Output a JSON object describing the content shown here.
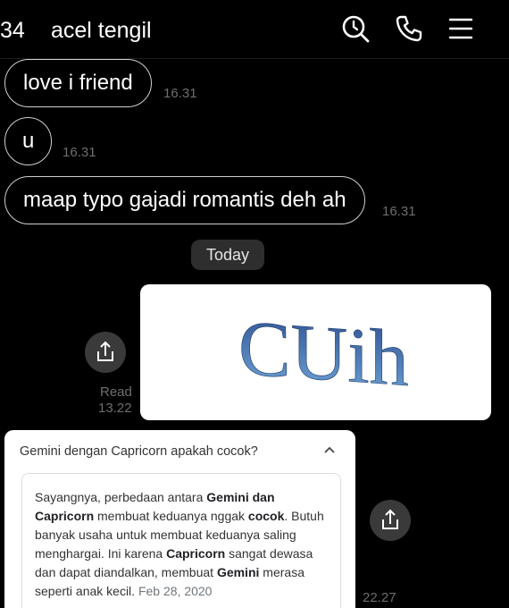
{
  "header": {
    "back_count": "34",
    "title": "acel tengil",
    "icons": [
      "search-icon",
      "phone-icon",
      "menu-icon"
    ]
  },
  "messages": [
    {
      "text": "love i friend",
      "time": "16.31"
    },
    {
      "text": "u",
      "time": "16.31"
    },
    {
      "text": "maap typo gajadi romantis deh ah",
      "time": "16.31"
    }
  ],
  "date_divider": "Today",
  "image_message": {
    "image_text": "CUih",
    "status": "Read",
    "time": "13.22"
  },
  "search_snippet": {
    "question": "Gemini dengan Capricorn apakah cocok?",
    "answer_parts": [
      {
        "t": "Sayangnya, perbedaan antara ",
        "b": false
      },
      {
        "t": "Gemini dan Capricorn",
        "b": true
      },
      {
        "t": " membuat keduanya nggak ",
        "b": false
      },
      {
        "t": "cocok",
        "b": true
      },
      {
        "t": ". Butuh banyak usaha untuk membuat keduanya saling menghargai. Ini karena ",
        "b": false
      },
      {
        "t": "Capricorn",
        "b": true
      },
      {
        "t": " sangat dewasa dan dapat diandalkan, membuat ",
        "b": false
      },
      {
        "t": "Gemini",
        "b": true
      },
      {
        "t": " merasa seperti anak kecil.",
        "b": false
      }
    ],
    "date": "Feb 28, 2020",
    "time": "22.27"
  },
  "colors": {
    "background": "#000000",
    "bubble_border": "#cfcfcf",
    "timestamp": "#6e6e6e",
    "chip": "#2e2e2e",
    "wordart_gradient": [
      "#2d4f8f",
      "#6fa6d8"
    ]
  }
}
